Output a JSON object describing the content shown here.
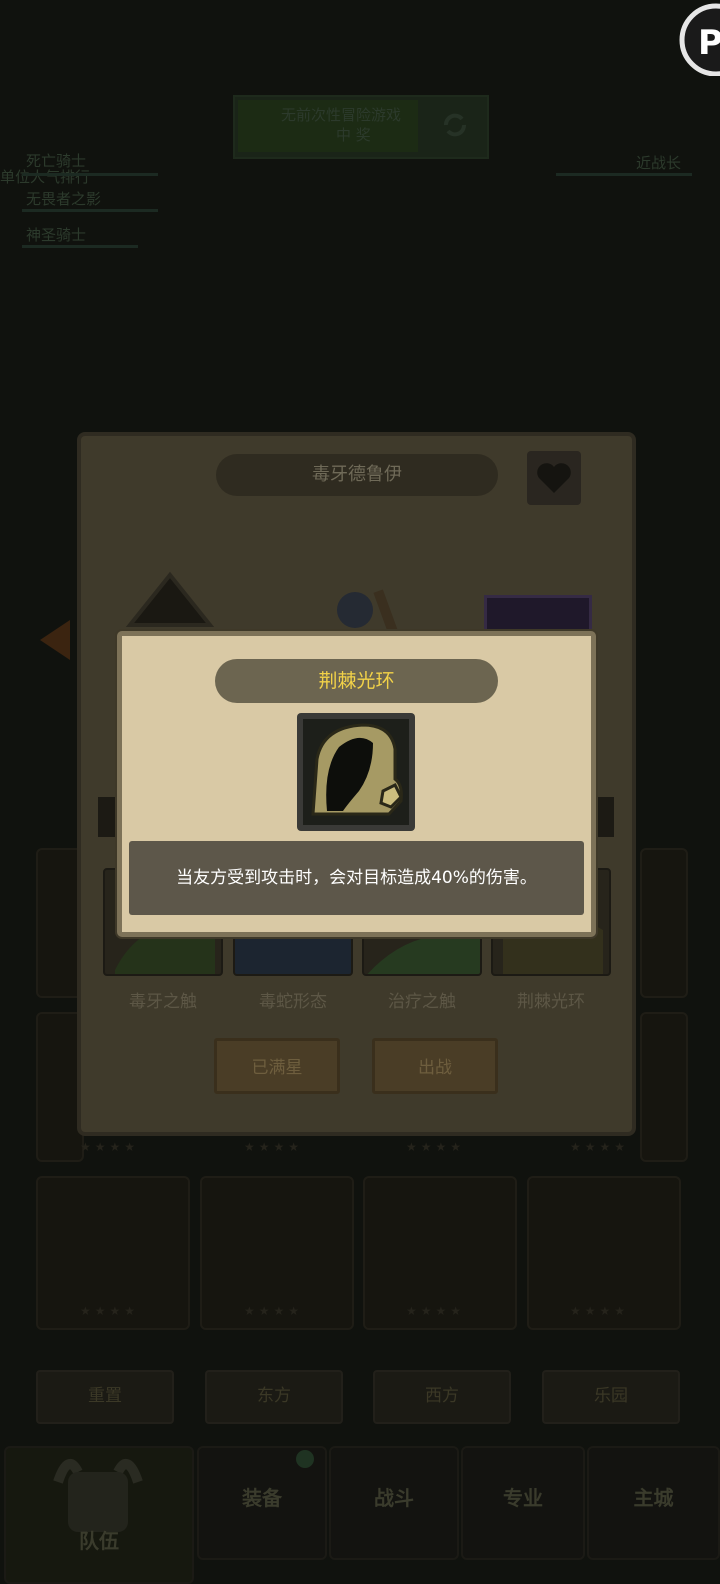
{
  "background": {
    "top_banner_text": "无前次性冒险游戏",
    "top_banner_sub": "中 奖",
    "left_list": [
      "死亡骑士",
      "无畏者之影",
      "神圣骑士"
    ],
    "left_overlap": "单位人气排行",
    "right_label": "近战长",
    "bottom_row_buttons": [
      "重置",
      "东方",
      "西方",
      "乐园"
    ],
    "nav": {
      "team": "队伍",
      "equipment": "装备",
      "battle": "战斗",
      "profession": "专业",
      "city": "主城"
    }
  },
  "dialog": {
    "title": "毒牙德鲁伊",
    "skills": [
      "毒牙之触",
      "毒蛇形态",
      "治疗之触",
      "荆棘光环"
    ],
    "buttons": {
      "max_star": "已满星",
      "deploy": "出战"
    }
  },
  "popup": {
    "title": "荆棘光环",
    "icon": "thorn-aura-icon",
    "description": "当友方受到攻击时，会对目标造成40%的伤害。"
  },
  "colors": {
    "popup_title_text": "#f2d248",
    "popup_bg": "#d9c9a5",
    "desc_bg": "#5d574a"
  }
}
